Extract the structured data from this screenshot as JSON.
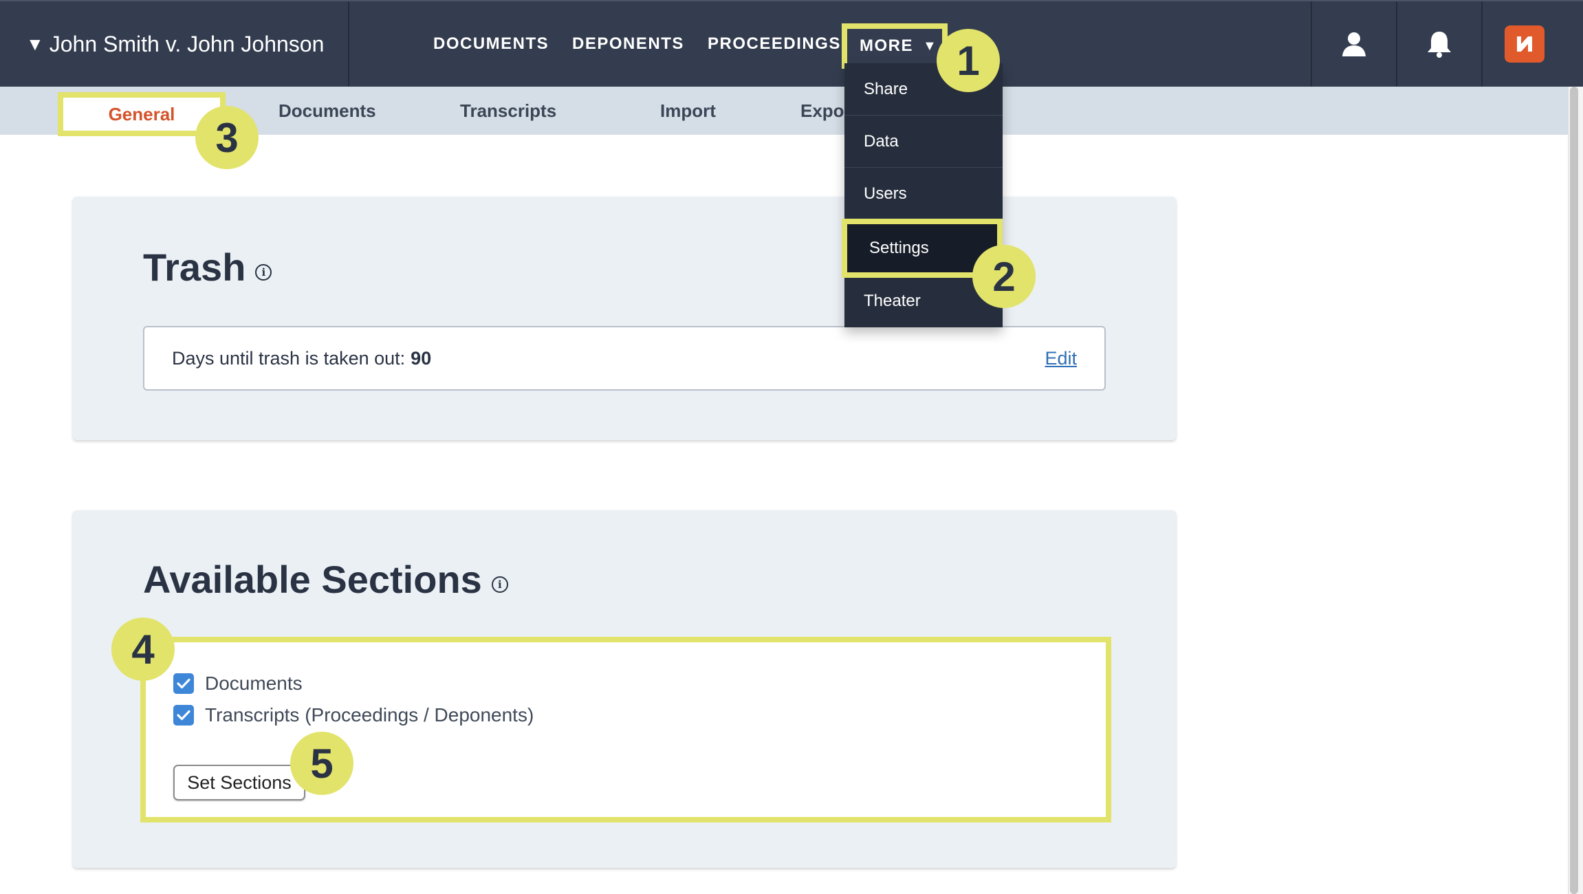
{
  "header": {
    "case_title": "John Smith v. John Johnson",
    "case_caret": "▼",
    "nav": [
      {
        "label": "DOCUMENTS"
      },
      {
        "label": "DEPONENTS"
      },
      {
        "label": "PROCEEDINGS"
      }
    ],
    "more_label": "MORE",
    "more_caret": "▼",
    "icons": [
      "user-icon",
      "bell-icon",
      "app-logo-icon"
    ]
  },
  "more_menu": {
    "items": [
      {
        "label": "Share"
      },
      {
        "label": "Data"
      },
      {
        "label": "Users"
      },
      {
        "label": "Settings"
      },
      {
        "label": "Theater"
      }
    ],
    "highlighted": "Settings"
  },
  "subnav": {
    "tabs": [
      {
        "label": "General"
      },
      {
        "label": "Documents"
      },
      {
        "label": "Transcripts"
      },
      {
        "label": "Import"
      },
      {
        "label": "Expor"
      }
    ],
    "active": "General"
  },
  "trash": {
    "title": "Trash",
    "days_label": "Days until trash is taken out:",
    "days_value": "90",
    "edit_label": "Edit"
  },
  "sections": {
    "title": "Available Sections",
    "options": [
      {
        "label": "Documents",
        "checked": true
      },
      {
        "label": "Transcripts (Proceedings / Deponents)",
        "checked": true
      }
    ],
    "button_label": "Set Sections"
  },
  "callouts": [
    "1",
    "2",
    "3",
    "4",
    "5"
  ],
  "colors": {
    "nav_bg": "#333d4f",
    "highlight": "#e2e36b",
    "active_tab": "#d4532b",
    "checkbox": "#3d86d8",
    "link": "#2f6fb5",
    "logo": "#e05a2b"
  }
}
